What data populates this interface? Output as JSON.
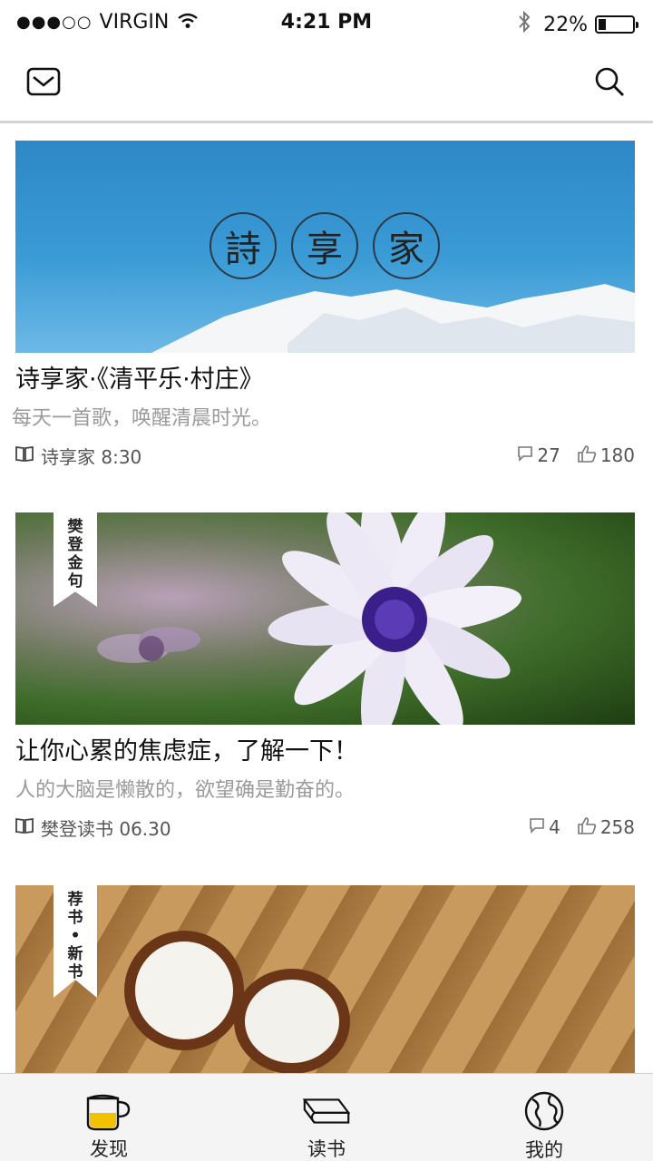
{
  "status_bar": {
    "carrier": "VIRGIN",
    "time": "4:21 PM",
    "battery_percent": "22%",
    "battery_level": 0.22
  },
  "nav": {
    "left_icon": "mail-icon",
    "right_icon": "search-icon"
  },
  "cards": [
    {
      "title": "诗享家·《清平乐·村庄》",
      "subtitle": "每天一首歌，唤醒清晨时光。",
      "source": "诗享家 8:30",
      "comments": "27",
      "likes": "180",
      "seal_chars": [
        "詩",
        "享",
        "家"
      ]
    },
    {
      "ribbon": [
        "樊",
        "登",
        "金",
        "句"
      ],
      "title": "让你心累的焦虑症，了解一下！",
      "subtitle": "人的大脑是懒散的，欲望确是勤奋的。",
      "source": "樊登读书 06.30",
      "comments": "4",
      "likes": "258"
    },
    {
      "ribbon": [
        "荐",
        "书",
        "•",
        "新",
        "书"
      ]
    }
  ],
  "tabs": [
    {
      "label": "发现",
      "icon": "cup-icon",
      "accent": "#f2c200"
    },
    {
      "label": "读书",
      "icon": "book-icon"
    },
    {
      "label": "我的",
      "icon": "globe-icon"
    }
  ]
}
